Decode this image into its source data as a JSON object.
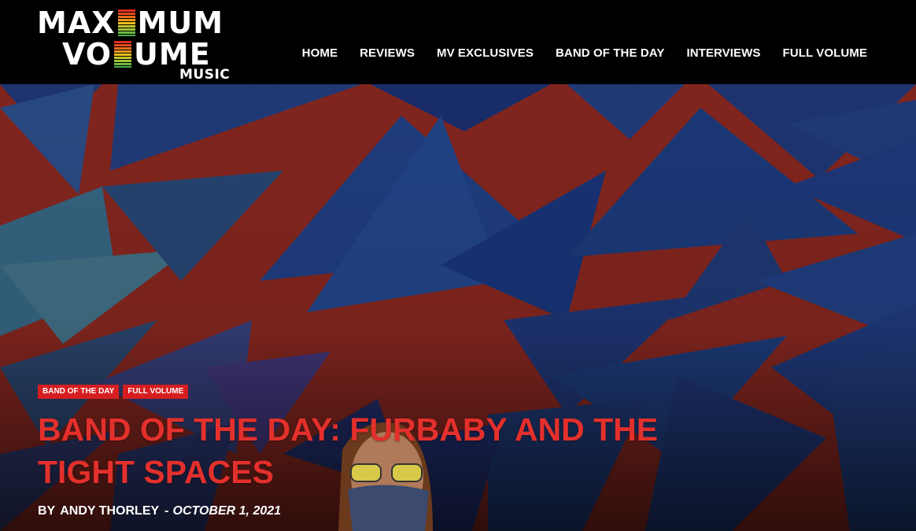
{
  "site": {
    "logo_line1_left": "MAX",
    "logo_line1_right": "MUM",
    "logo_line2_left": "VO",
    "logo_line2_right": "UME",
    "logo_sub": "MUSIC"
  },
  "nav": {
    "items": [
      {
        "label": "HOME"
      },
      {
        "label": "REVIEWS"
      },
      {
        "label": "MV EXCLUSIVES"
      },
      {
        "label": "BAND OF THE DAY"
      },
      {
        "label": "INTERVIEWS"
      },
      {
        "label": "FULL VOLUME"
      }
    ]
  },
  "article": {
    "tags": [
      {
        "label": "BAND OF THE DAY"
      },
      {
        "label": "FULL VOLUME"
      }
    ],
    "title": "BAND OF THE DAY: FURBABY AND THE TIGHT SPACES",
    "by_prefix": "BY",
    "author": "ANDY THORLEY",
    "separator": "-",
    "date": "OCTOBER 1, 2021"
  },
  "colors": {
    "accent_red": "#d61e20",
    "headline_red": "#e3302c",
    "header_bg": "#000000",
    "mural_red": "#b8352b",
    "mural_blue": "#1f3f9a"
  }
}
